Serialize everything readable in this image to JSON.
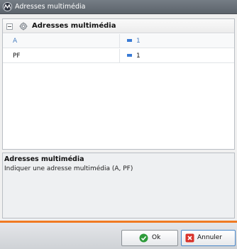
{
  "window": {
    "title": "Adresses multimédia",
    "icon": "app-logo-icon"
  },
  "property_grid": {
    "group_title": "Adresses multimédia",
    "group_icon": "gear-icon",
    "rows": [
      {
        "name": "A",
        "value": "1"
      },
      {
        "name": "PF",
        "value": "1"
      }
    ]
  },
  "description": {
    "title": "Adresses multimédia",
    "text": "Indiquer une adresse multimédia (A, PF)"
  },
  "buttons": {
    "ok_label": "Ok",
    "cancel_label": "Annuler"
  },
  "colors": {
    "accent_bar": "#f07a22",
    "ok_icon": "#2e9b3a",
    "cancel_icon": "#d9332b",
    "value_icon": "#3a7bd5"
  }
}
